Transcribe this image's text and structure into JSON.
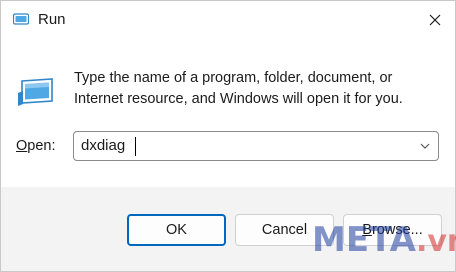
{
  "window": {
    "title": "Run"
  },
  "content": {
    "description_line1": "Type the name of a program, folder, document, or",
    "description_line2": "Internet resource, and Windows will open it for you.",
    "open_label_accel": "O",
    "open_label_rest": "pen:",
    "open_value": "dxdiag"
  },
  "buttons": {
    "ok": "OK",
    "cancel": "Cancel",
    "browse_accel": "B",
    "browse_rest": "rowse..."
  },
  "watermark": {
    "part1": "META",
    "part2": ".vn"
  },
  "colors": {
    "accent": "#0067c0",
    "icon_blue": "#3a9ad9"
  }
}
